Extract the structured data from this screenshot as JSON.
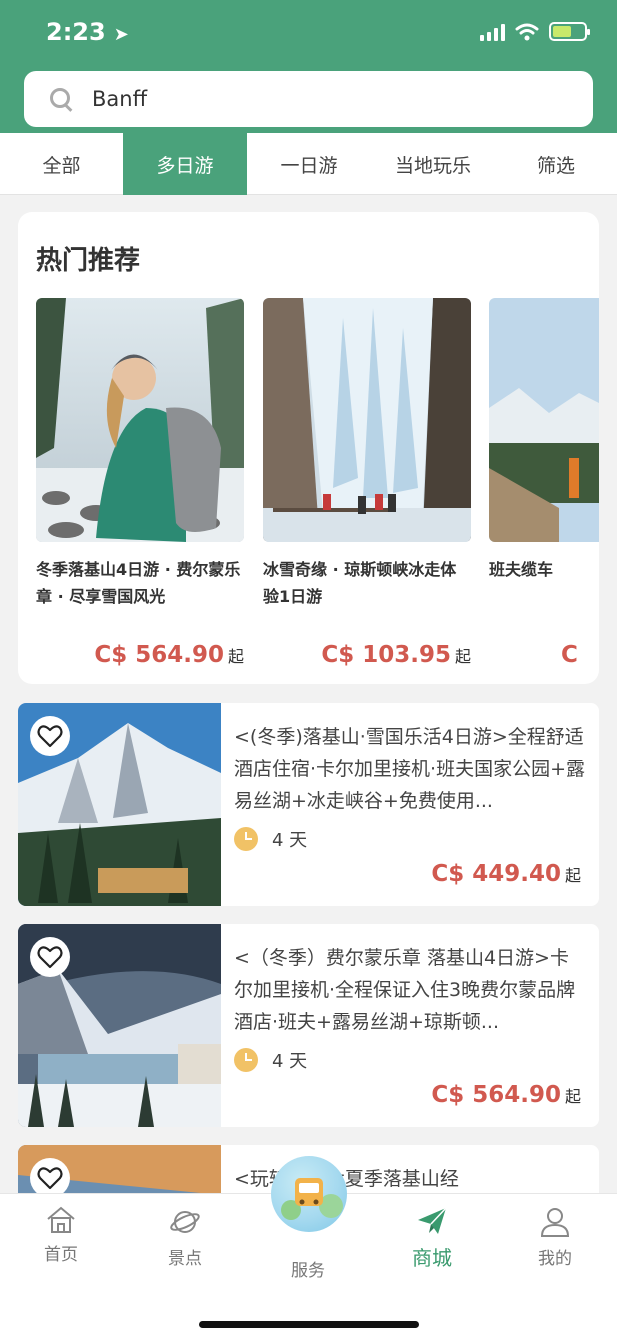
{
  "status": {
    "time": "2:23"
  },
  "search": {
    "value": "Banff"
  },
  "tabs": [
    "全部",
    "多日游",
    "一日游",
    "当地玩乐",
    "筛选"
  ],
  "hot": {
    "title": "热门推荐",
    "cards": [
      {
        "name": "冬季落基山4日游 · 费尔蒙乐章 · 尽享雪国风光",
        "price": "C$ 564.90",
        "suffix": "起"
      },
      {
        "name": "冰雪奇缘 · 琼斯顿峡冰走体验1日游",
        "price": "C$ 103.95",
        "suffix": "起"
      },
      {
        "name": "班夫缆车",
        "price": "C",
        "suffix": ""
      }
    ]
  },
  "items": [
    {
      "title": "<(冬季)落基山·雪国乐活4日游>全程舒适酒店住宿·卡尔加里接机·班夫国家公园+露易丝湖+冰走峡谷+免费使用...",
      "duration": "4 天",
      "price": "C$ 449.40",
      "suffix": "起"
    },
    {
      "title": "<（冬季）费尔蒙乐章 落基山4日游>卡尔加里接机·全程保证入住3晚费尔蒙品牌酒店·班夫+露易丝湖+琼斯顿...",
      "duration": "4 天",
      "price": "C$ 564.90",
      "suffix": "起"
    },
    {
      "title": "<玩转加拿大夏季落基山经",
      "duration": "",
      "price": "",
      "suffix": ""
    }
  ],
  "nav": [
    {
      "label": "首页",
      "icon": "home-icon"
    },
    {
      "label": "景点",
      "icon": "planet-icon"
    },
    {
      "label": "服务",
      "icon": "bus-icon"
    },
    {
      "label": "商城",
      "icon": "paper-plane-icon"
    },
    {
      "label": "我的",
      "icon": "user-icon"
    }
  ],
  "colors": {
    "brand": "#4aa27b",
    "price": "#d1594f",
    "clock": "#f1c266"
  }
}
